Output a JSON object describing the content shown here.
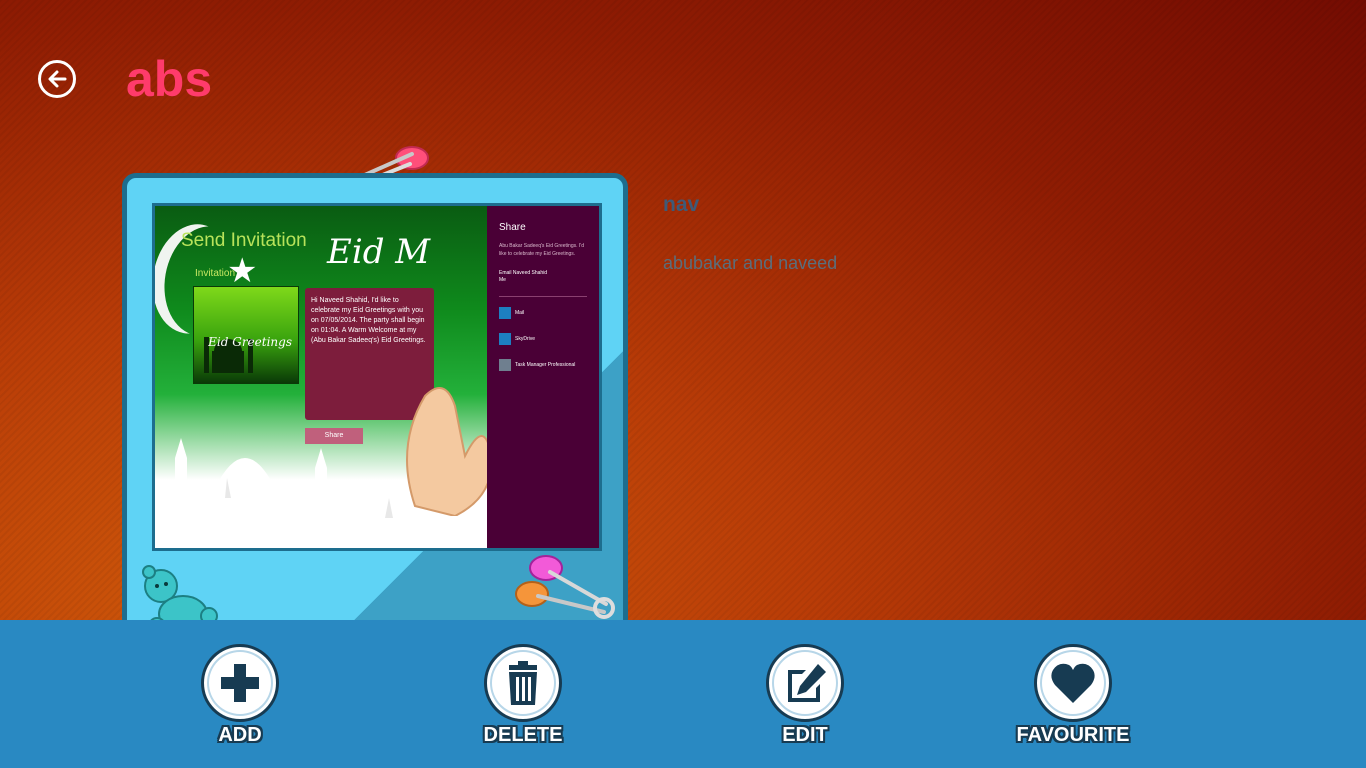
{
  "header": {
    "title": "abs"
  },
  "preview": {
    "send_title": "Send Invitation",
    "invitation_label": "Invitation",
    "eid_heading": "Eid M",
    "thumb_text": "Eid Greetings",
    "message": "Hi Naveed Shahid, I'd like to celebrate my Eid Greetings with you on 07/05/2014. The party shall begin on 01:04. A Warm Welcome at my (Abu Bakar Sadeeq's) Eid Greetings.",
    "share_button": "Share",
    "share_panel": {
      "title": "Share",
      "description": "Abu Bakar Sadeeq's Eid Greetings. I'd like to celebrate my Eid Greetings.",
      "user_name": "Email Naveed Shahid",
      "user_sub": "Me",
      "apps": [
        "Mail",
        "SkyDrive",
        "Task Manager Professional"
      ]
    }
  },
  "detail": {
    "name": "nav",
    "description": "abubakar and naveed"
  },
  "app_bar": {
    "add_label": "ADD",
    "delete_label": "DELETE",
    "edit_label": "EDIT",
    "favourite_label": "FAVOURITE"
  },
  "colors": {
    "title": "#ff3b6b",
    "app_bar": "#2989c2",
    "frame": "#5fd3f5"
  }
}
